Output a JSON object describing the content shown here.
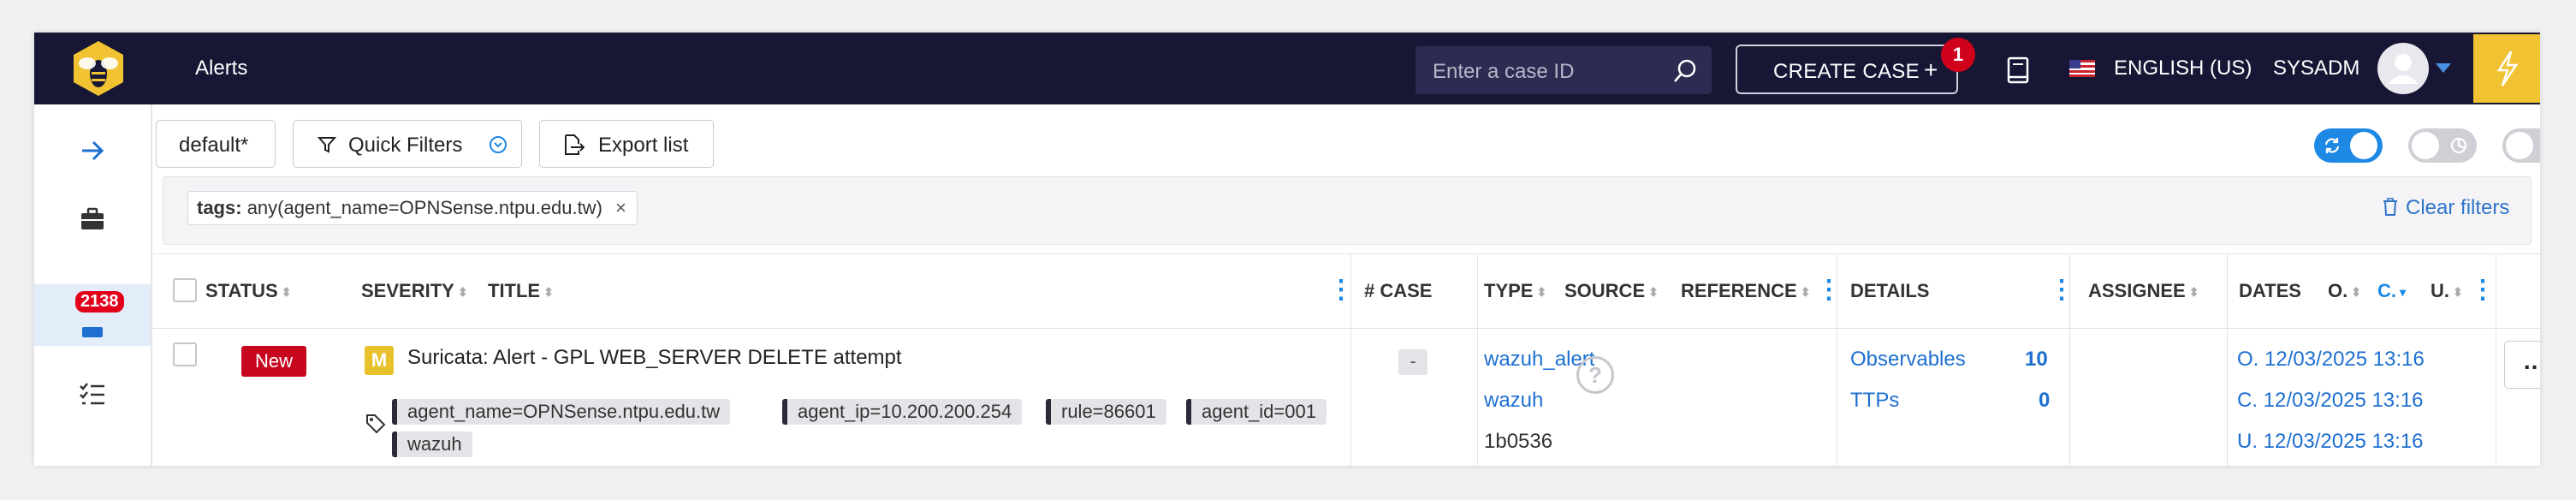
{
  "topbar": {
    "title": "Alerts",
    "case_search_placeholder": "Enter a case ID",
    "create_case_label": "CREATE CASE",
    "create_case_icon": "plus-icon",
    "notification_count": "1",
    "language": "ENGLISH (US)",
    "username": "SYSADM",
    "colors": {
      "bar": "#171735",
      "accent": "#f1c232",
      "badge": "#d0021b"
    }
  },
  "sidebar": {
    "alerts_count": "2138",
    "items": [
      {
        "icon": "arrow-right-icon"
      },
      {
        "icon": "briefcase-icon"
      },
      {
        "icon": "alerts-icon"
      },
      {
        "icon": "tasks-list-icon"
      }
    ]
  },
  "toolbar": {
    "default_label": "default*",
    "quick_filters_label": "Quick Filters",
    "export_label": "Export list",
    "auto_refresh_on": true
  },
  "filters": {
    "tag_key": "tags:",
    "tag_value": "any(agent_name=OPNSense.ntpu.edu.tw)",
    "remove": "×",
    "clear_label": "Clear filters"
  },
  "table": {
    "headers": {
      "status": "STATUS",
      "severity": "SEVERITY",
      "title": "TITLE",
      "case": "# CASE",
      "type": "TYPE",
      "source": "SOURCE",
      "reference": "REFERENCE",
      "details": "DETAILS",
      "assignee": "ASSIGNEE",
      "dates": "DATES",
      "date_o": "O.",
      "date_c": "C.",
      "date_u": "U."
    },
    "rows": [
      {
        "status": "New",
        "severity": "M",
        "title": "Suricata: Alert - GPL WEB_SERVER DELETE attempt",
        "tags": [
          "agent_name=OPNSense.ntpu.edu.tw",
          "agent_ip=10.200.200.254",
          "rule=86601",
          "agent_id=001",
          "wazuh"
        ],
        "case": "-",
        "type": "wazuh_alert",
        "source": "wazuh",
        "reference": "1b0536",
        "observables_label": "Observables",
        "observables_count": "10",
        "ttps_label": "TTPs",
        "ttps_count": "0",
        "assignee": "?",
        "date_o": "O. 12/03/2025 13:16",
        "date_c": "C. 12/03/2025 13:16",
        "date_u": "U. 12/03/2025 13:16",
        "actions": "..."
      }
    ]
  }
}
